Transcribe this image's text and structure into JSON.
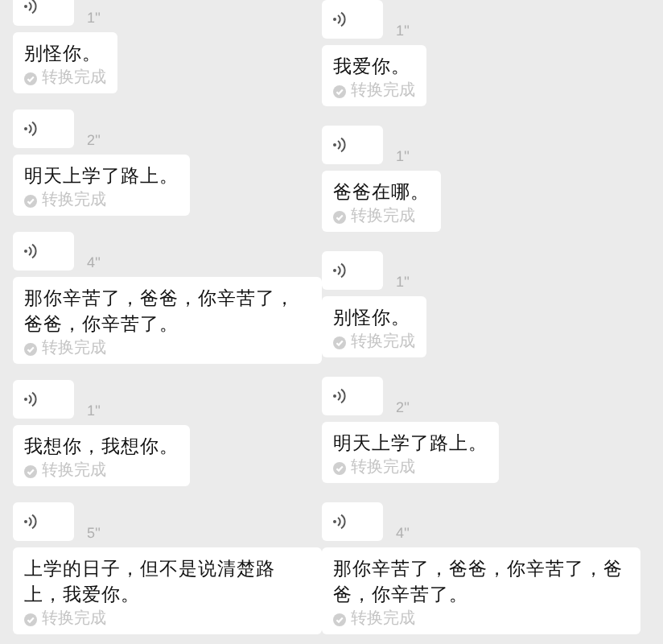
{
  "columns": [
    {
      "messages": [
        {
          "duration": "1''",
          "text": "别怪你。",
          "status": "转换完成"
        },
        {
          "duration": "2''",
          "text": "明天上学了路上。",
          "status": "转换完成"
        },
        {
          "duration": "4''",
          "text": "那你辛苦了，爸爸，你辛苦了，爸爸，你辛苦了。",
          "status": "转换完成"
        },
        {
          "duration": "1''",
          "text": "我想你，我想你。",
          "status": "转换完成"
        },
        {
          "duration": "5''",
          "text": "上学的日子，但不是说清楚路上，我爱你。",
          "status": "转换完成"
        }
      ]
    },
    {
      "messages": [
        {
          "duration": "1''",
          "text": "我爱你。",
          "status": "转换完成"
        },
        {
          "duration": "1''",
          "text": "爸爸在哪。",
          "status": "转换完成"
        },
        {
          "duration": "1''",
          "text": "别怪你。",
          "status": "转换完成"
        },
        {
          "duration": "2''",
          "text": "明天上学了路上。",
          "status": "转换完成"
        },
        {
          "duration": "4''",
          "text": "那你辛苦了，爸爸，你辛苦了，爸爸，你辛苦了。",
          "status": "转换完成"
        }
      ]
    }
  ]
}
